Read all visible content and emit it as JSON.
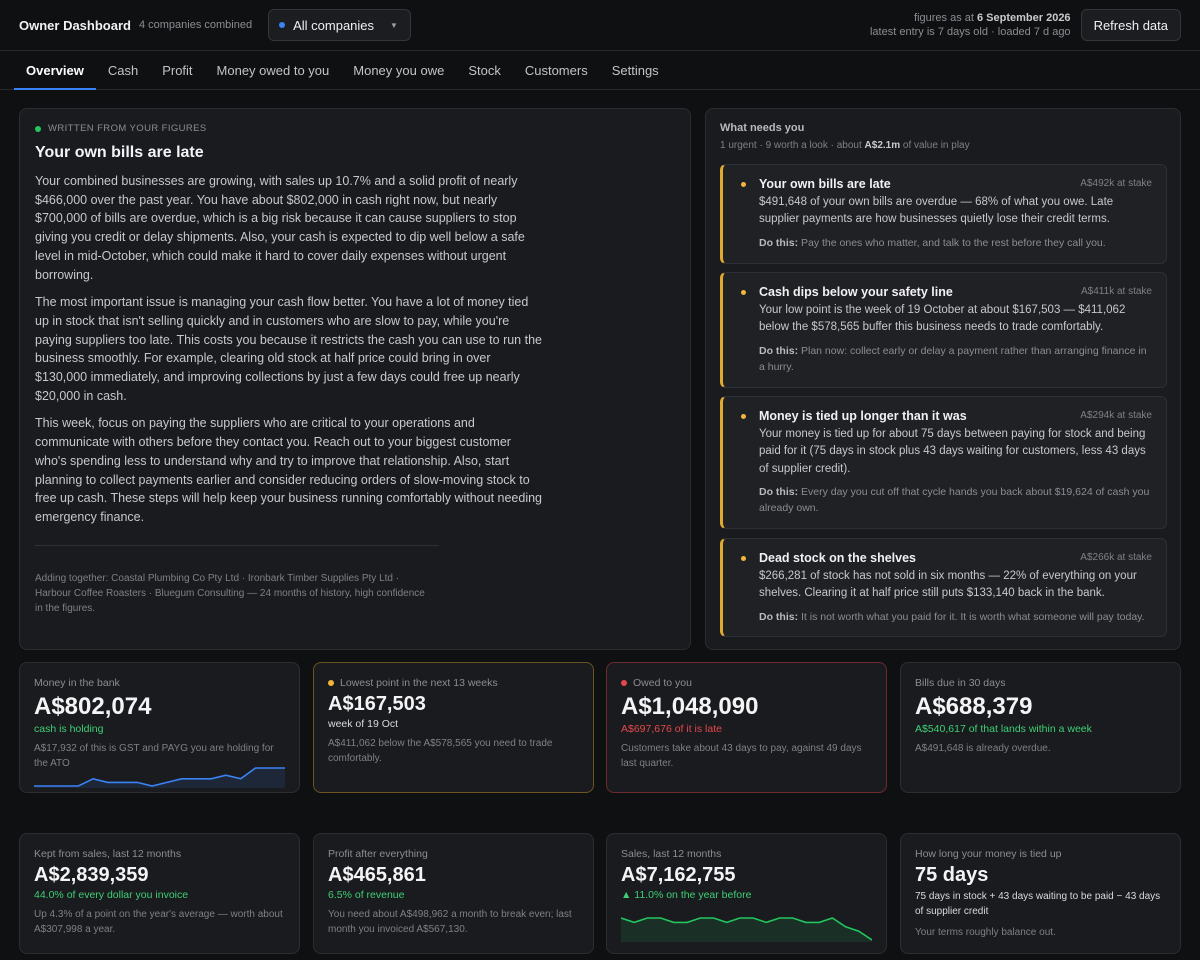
{
  "header": {
    "title": "Owner Dashboard",
    "subtitle": "4 companies combined",
    "selector_label": "All companies",
    "asof_prefix": "figures as at",
    "asof_date": "6 September 2026",
    "asof_line2": "latest entry is 7 days old · loaded 7 d ago",
    "refresh_label": "Refresh data"
  },
  "tabs": [
    "Overview",
    "Cash",
    "Profit",
    "Money owed to you",
    "Money you owe",
    "Stock",
    "Customers",
    "Settings"
  ],
  "summary": {
    "eyebrow": "WRITTEN FROM YOUR FIGURES",
    "title": "Your own bills are late",
    "paragraphs": [
      "Your combined businesses are growing, with sales up 10.7% and a solid profit of nearly $466,000 over the past year. You have about $802,000 in cash right now, but nearly $700,000 of bills are overdue, which is a big risk because it can cause suppliers to stop giving you credit or delay shipments. Also, your cash is expected to dip well below a safe level in mid-October, which could make it hard to cover daily expenses without urgent borrowing.",
      "The most important issue is managing your cash flow better. You have a lot of money tied up in stock that isn't selling quickly and in customers who are slow to pay, while you're paying suppliers too late. This costs you because it restricts the cash you can use to run the business smoothly. For example, clearing old stock at half price could bring in over $130,000 immediately, and improving collections by just a few days could free up nearly $20,000 in cash.",
      "This week, focus on paying the suppliers who are critical to your operations and communicate with others before they contact you. Reach out to your biggest customer who's spending less to understand why and try to improve that relationship. Also, start planning to collect payments earlier and consider reducing orders of slow-moving stock to free up cash. These steps will help keep your business running comfortably without needing emergency finance."
    ],
    "footer": "Adding together: Coastal Plumbing Co Pty Ltd · Ironbark Timber Supplies Pty Ltd · Harbour Coffee Roasters · Bluegum Consulting — 24 months of history, high confidence in the figures."
  },
  "needs": {
    "title": "What needs you",
    "sub_prefix": "1 urgent · 9 worth a look · about",
    "sub_value": "A$2.1m",
    "sub_suffix": "of value in play",
    "items": [
      {
        "title": "Your own bills are late",
        "stake": "A$492k at stake",
        "body": "$491,648 of your own bills are overdue — 68% of what you owe. Late supplier payments are how businesses quietly lose their credit terms.",
        "todo_label": "Do this:",
        "todo": "Pay the ones who matter, and talk to the rest before they call you."
      },
      {
        "title": "Cash dips below your safety line",
        "stake": "A$411k at stake",
        "body": "Your low point is the week of 19 October at about $167,503 — $411,062 below the $578,565 buffer this business needs to trade comfortably.",
        "todo_label": "Do this:",
        "todo": "Plan now: collect early or delay a payment rather than arranging finance in a hurry."
      },
      {
        "title": "Money is tied up longer than it was",
        "stake": "A$294k at stake",
        "body": "Your money is tied up for about 75 days between paying for stock and being paid for it (75 days in stock plus 43 days waiting for customers, less 43 days of supplier credit).",
        "todo_label": "Do this:",
        "todo": "Every day you cut off that cycle hands you back about $19,624 of cash you already own."
      },
      {
        "title": "Dead stock on the shelves",
        "stake": "A$266k at stake",
        "body": "$266,281 of stock has not sold in six months — 22% of everything on your shelves. Clearing it at half price still puts $133,140 back in the bank.",
        "todo_label": "Do this:",
        "todo": "It is not worth what you paid for it. It is worth what someone will pay today."
      }
    ]
  },
  "metrics": {
    "bank": {
      "label": "Money in the bank",
      "value": "A$802,074",
      "note": "cash is holding",
      "desc": "A$17,932 of this is GST and PAYG you are holding for the ATO",
      "spark": [
        3,
        3,
        3,
        3,
        5,
        4,
        4,
        4,
        3,
        4,
        5,
        5,
        5,
        6,
        5,
        8,
        8,
        8
      ],
      "color": "#3b82f6"
    },
    "lowest": {
      "label": "Lowest point in the next 13 weeks",
      "value": "A$167,503",
      "note": "week of 19 Oct",
      "desc": "A$411,062 below the A$578,565 you need to trade comfortably.",
      "dot": "#f3b53b"
    },
    "owed": {
      "label": "Owed to you",
      "value": "A$1,048,090",
      "note": "A$697,676 of it is late",
      "desc": "Customers take about 43 days to pay, against 49 days last quarter.",
      "dot": "#e5484d"
    },
    "bills": {
      "label": "Bills due in 30 days",
      "value": "A$688,379",
      "note": "A$540,617 of that lands within a week",
      "desc": "A$491,648 is already overdue."
    },
    "kept": {
      "label": "Kept from sales, last 12 months",
      "value": "A$2,839,359",
      "note": "44.0% of every dollar you invoice",
      "desc": "Up 4.3% of a point on the year's average — worth about A$307,998 a year."
    },
    "profit": {
      "label": "Profit after everything",
      "value": "A$465,861",
      "note": "6.5% of revenue",
      "desc": "You need about A$498,962 a month to break even; last month you invoiced A$567,130."
    },
    "sales": {
      "label": "Sales, last 12 months",
      "value": "A$7,162,755",
      "note": "▲ 11.0% on the year before",
      "spark": [
        6,
        5,
        6,
        6,
        5,
        5,
        6,
        6,
        5,
        6,
        6,
        5,
        6,
        6,
        5,
        5,
        6,
        4,
        3,
        1
      ],
      "color": "#22c55e"
    },
    "tied": {
      "label": "How long your money is tied up",
      "value": "75 days",
      "note": "75 days in stock + 43 days waiting to be paid − 43 days of supplier credit",
      "desc": "Your terms roughly balance out."
    }
  }
}
